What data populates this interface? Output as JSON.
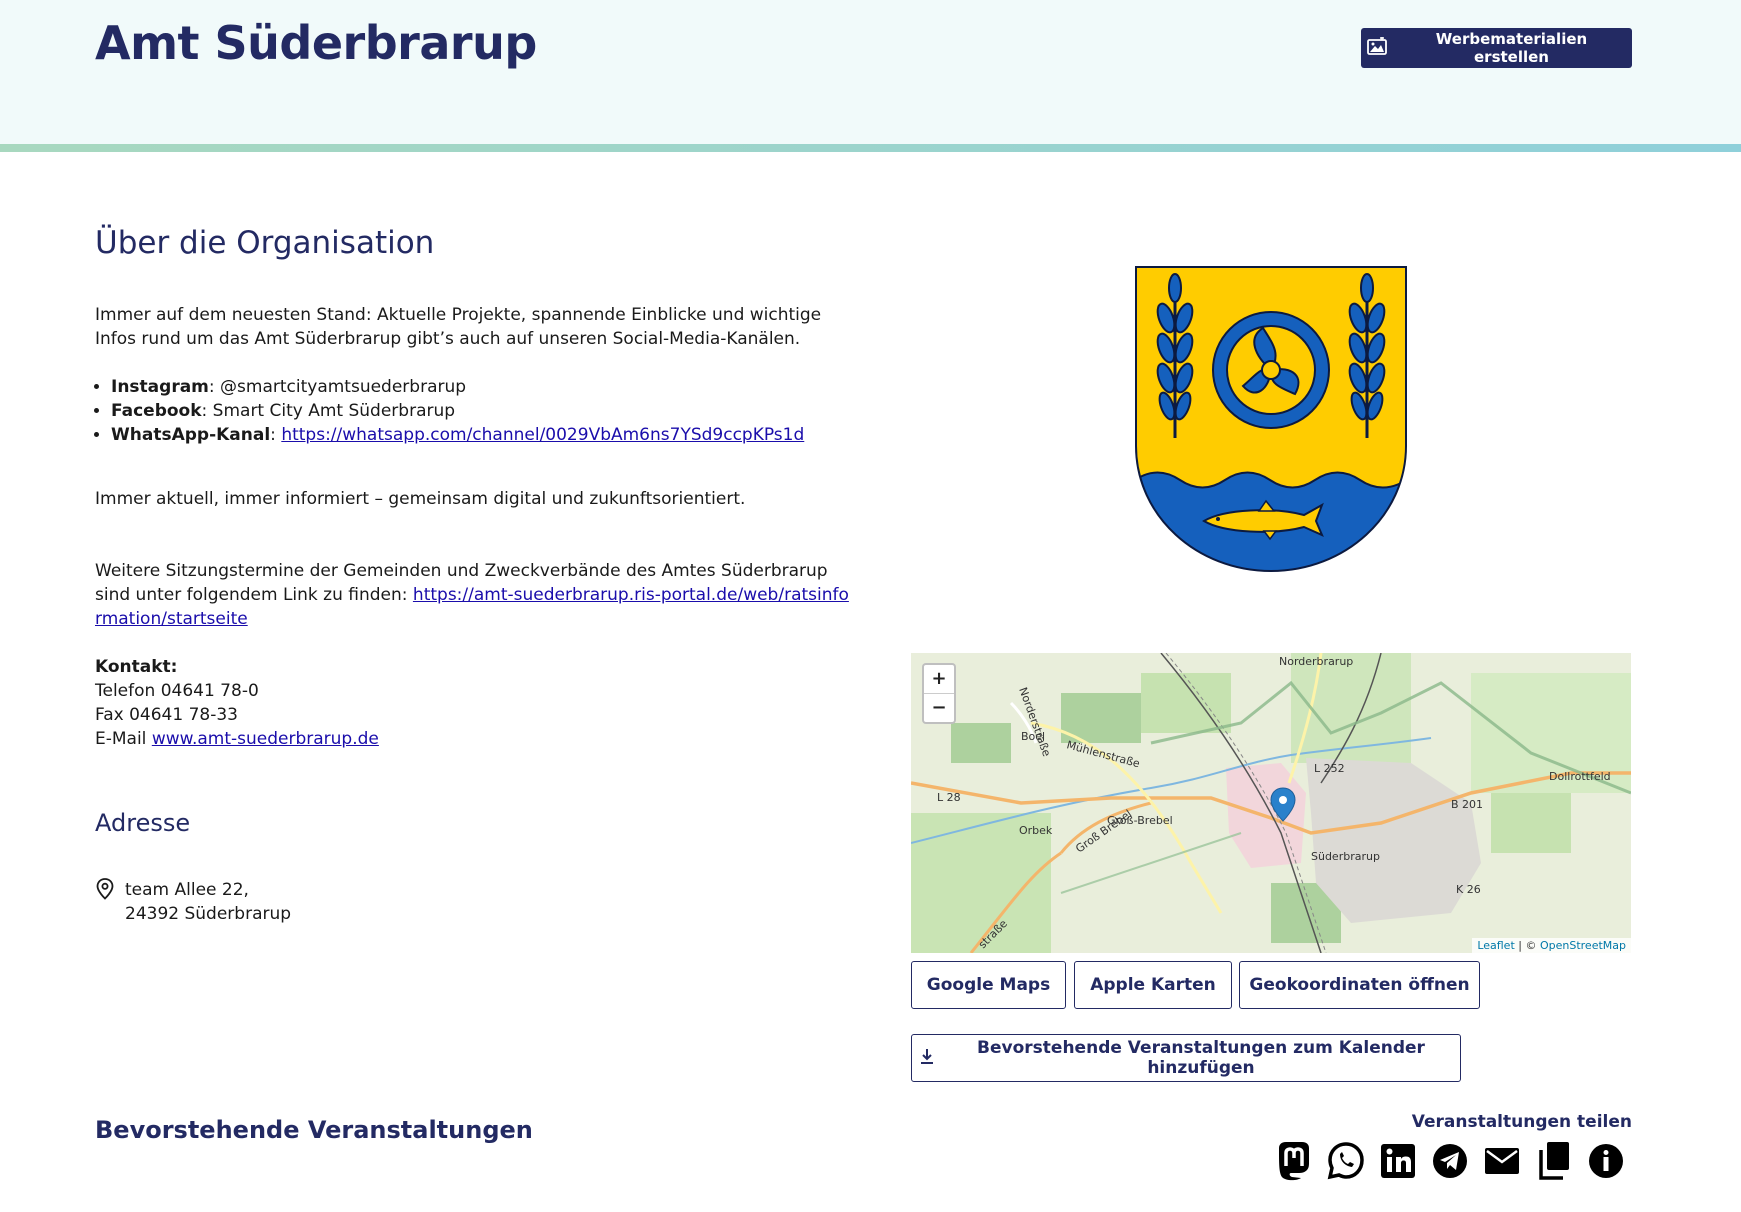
{
  "header": {
    "title": "Amt Süderbrarup",
    "werbe_button": "Werbematerialien erstellen"
  },
  "about": {
    "heading": "Über die Organisation",
    "intro": "Immer auf dem neuesten Stand: Aktuelle Projekte, spannende Einblicke und wichtige Infos rund um das Amt Süderbrarup gibt’s auch auf unseren Social-Media-Kanälen.",
    "social": [
      {
        "label": "Instagram",
        "value": "@smartcityamtsuederbrarup"
      },
      {
        "label": "Facebook",
        "value": "Smart City Amt Süderbrarup"
      },
      {
        "label": "WhatsApp-Kanal",
        "value": "https://whatsapp.com/channel/0029VbAm6ns7YSd9ccpKPs1d"
      }
    ],
    "tagline": "Immer aktuell, immer informiert – gemeinsam digital und zukunftsorientiert.",
    "sessions_text": "Weitere Sitzungstermine der Gemeinden und Zweckverbände des Amtes Süderbrarup sind unter folgendem Link zu finden: ",
    "sessions_link": "https://amt-suederbrarup.ris-portal.de/web/ratsinformation/startseite",
    "contact_label": "Kontakt:",
    "phone": "Telefon 04641 78-0",
    "fax": "Fax 04641 78-33",
    "email_prefix": "E-Mail ",
    "email_link": "www.amt-suederbrarup.de"
  },
  "address": {
    "heading": "Adresse",
    "line1": "team Allee 22,",
    "line2": "24392 Süderbrarup"
  },
  "map": {
    "zoom_in": "+",
    "zoom_out": "−",
    "labels": {
      "norderbrarup": "Norderbrarup",
      "boel": "Boel",
      "muehlenstrasse": "Mühlenstraße",
      "norderstrasse": "Norderstraße",
      "l252": "L 252",
      "l28": "L 28",
      "dollrottfeld": "Dollrottfeld",
      "b201": "B 201",
      "grossbrebel": "Groß-Brebel",
      "grossbrebel_road": "Groß Brebel",
      "orbek": "Orbek",
      "suederbrarup": "Süderbrarup",
      "k26": "K 26",
      "strasse": "straße"
    },
    "attr_leaflet": "Leaflet",
    "attr_sep": " | © ",
    "attr_osm": "OpenStreetMap",
    "buttons": {
      "google": "Google Maps",
      "apple": "Apple Karten",
      "geo": "Geokoordinaten öffnen"
    },
    "calendar_button": "Bevorstehende Veranstaltungen zum Kalender hinzufügen"
  },
  "events": {
    "heading": "Bevorstehende Veranstaltungen",
    "share_label": "Veranstaltungen teilen"
  },
  "icons": {
    "share": [
      "mastodon-icon",
      "whatsapp-icon",
      "linkedin-icon",
      "telegram-icon",
      "email-icon",
      "copy-icon",
      "info-icon"
    ]
  },
  "colors": {
    "brand_navy": "#232a63",
    "header_bg": "#f1fafa",
    "coat_yellow": "#ffcc00",
    "coat_blue": "#1560bd"
  }
}
